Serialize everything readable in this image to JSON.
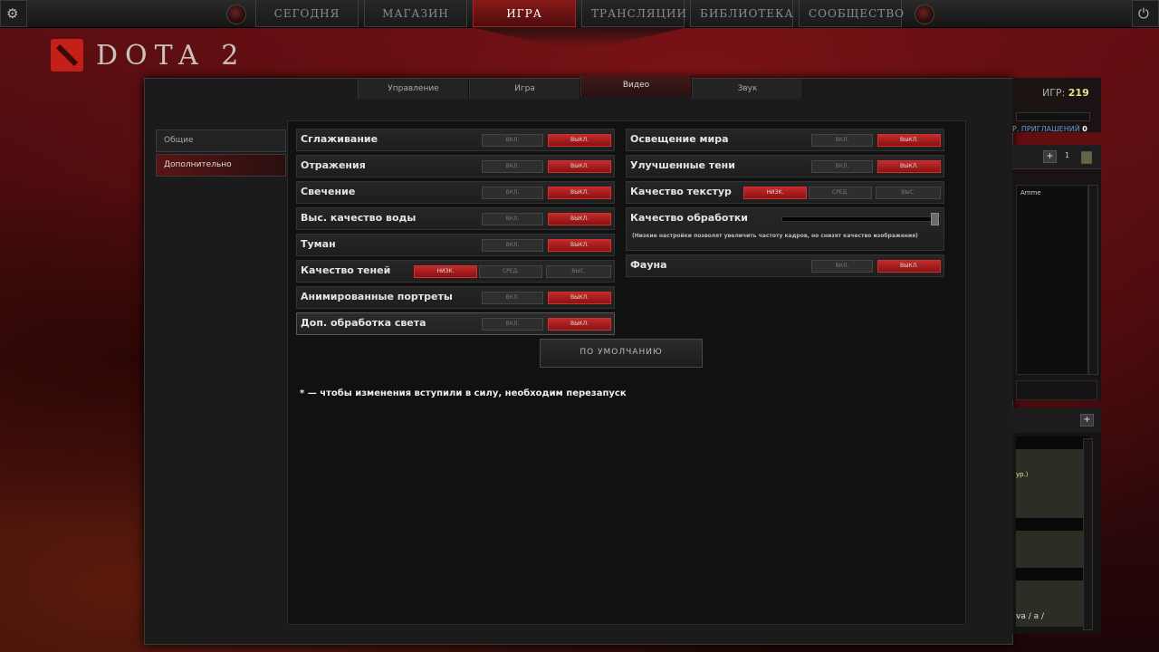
{
  "nav": {
    "tabs": [
      {
        "label": "СЕГОДНЯ"
      },
      {
        "label": "МАГАЗИН"
      },
      {
        "label": "ИГРА"
      },
      {
        "label": "ТРАНСЛЯЦИИ"
      },
      {
        "label": "БИБЛИОТЕКА"
      },
      {
        "label": "СООБЩЕСТВО"
      }
    ],
    "active_tab": "ИГРА",
    "settings_icon": "⚙",
    "power_icon": "⏻"
  },
  "logo": {
    "text": "DOTA 2"
  },
  "settings": {
    "tabs": [
      {
        "label": "Управление"
      },
      {
        "label": "Игра"
      },
      {
        "label": "Видео"
      },
      {
        "label": "Звук"
      }
    ],
    "active_tab": "Видео",
    "side": [
      {
        "label": "Общие"
      },
      {
        "label": "Дополнительно"
      }
    ],
    "active_side": "Дополнительно",
    "left": [
      {
        "label": "Сглаживание",
        "on": "ВКЛ.",
        "off": "ВЫКЛ.",
        "value": "ВЫКЛ."
      },
      {
        "label": "Отражения",
        "on": "ВКЛ.",
        "off": "ВЫКЛ.",
        "value": "ВЫКЛ."
      },
      {
        "label": "Свечение",
        "on": "ВКЛ.",
        "off": "ВЫКЛ.",
        "value": "ВЫКЛ."
      },
      {
        "label": "Выс. качество воды",
        "on": "ВКЛ.",
        "off": "ВЫКЛ.",
        "value": "ВЫКЛ."
      },
      {
        "label": "Туман",
        "on": "ВКЛ.",
        "off": "ВЫКЛ.",
        "value": "ВЫКЛ."
      },
      {
        "label": "Качество теней",
        "low": "НИЗК.",
        "mid": "СРЕД.",
        "high": "ВЫС.",
        "value": "НИЗК."
      },
      {
        "label": "Анимированные портреты",
        "on": "ВКЛ.",
        "off": "ВЫКЛ.",
        "value": "ВЫКЛ."
      },
      {
        "label": "Доп. обработка света",
        "on": "ВКЛ.",
        "off": "ВЫКЛ.",
        "value": "ВЫКЛ."
      }
    ],
    "right": [
      {
        "label": "Освещение мира",
        "on": "ВКЛ.",
        "off": "ВЫКЛ.",
        "value": "ВЫКЛ."
      },
      {
        "label": "Улучшенные тени",
        "on": "ВКЛ.",
        "off": "ВЫКЛ.",
        "value": "ВЫКЛ."
      },
      {
        "label": "Качество текстур",
        "low": "НИЗК.",
        "mid": "СРЕД.",
        "high": "ВЫС.",
        "value": "НИЗК."
      },
      {
        "label": "Фауна",
        "on": "ВКЛ.",
        "off": "ВЫКЛ.",
        "value": "ВЫКЛ."
      }
    ],
    "processing": {
      "label": "Качество обработки",
      "note": "(Низкие настройки позволят увеличить частоту кадров, но снизят качество изображения)",
      "slider_level": 1.0
    },
    "default_button": "ПО УМОЛЧАНИЮ",
    "restart_note": "* — чтобы изменения вступили в силу, необходим перезапуск"
  },
  "right_panel": {
    "games_label": "ИГР:",
    "games_count": "219",
    "invites_label": "Р. ПРИГЛАШЕНИЙ",
    "invites_count": "0",
    "friends_count": "1",
    "friend_name": "Amme",
    "chat_line1": "ур.)",
    "chat_line2": "va / a /"
  }
}
